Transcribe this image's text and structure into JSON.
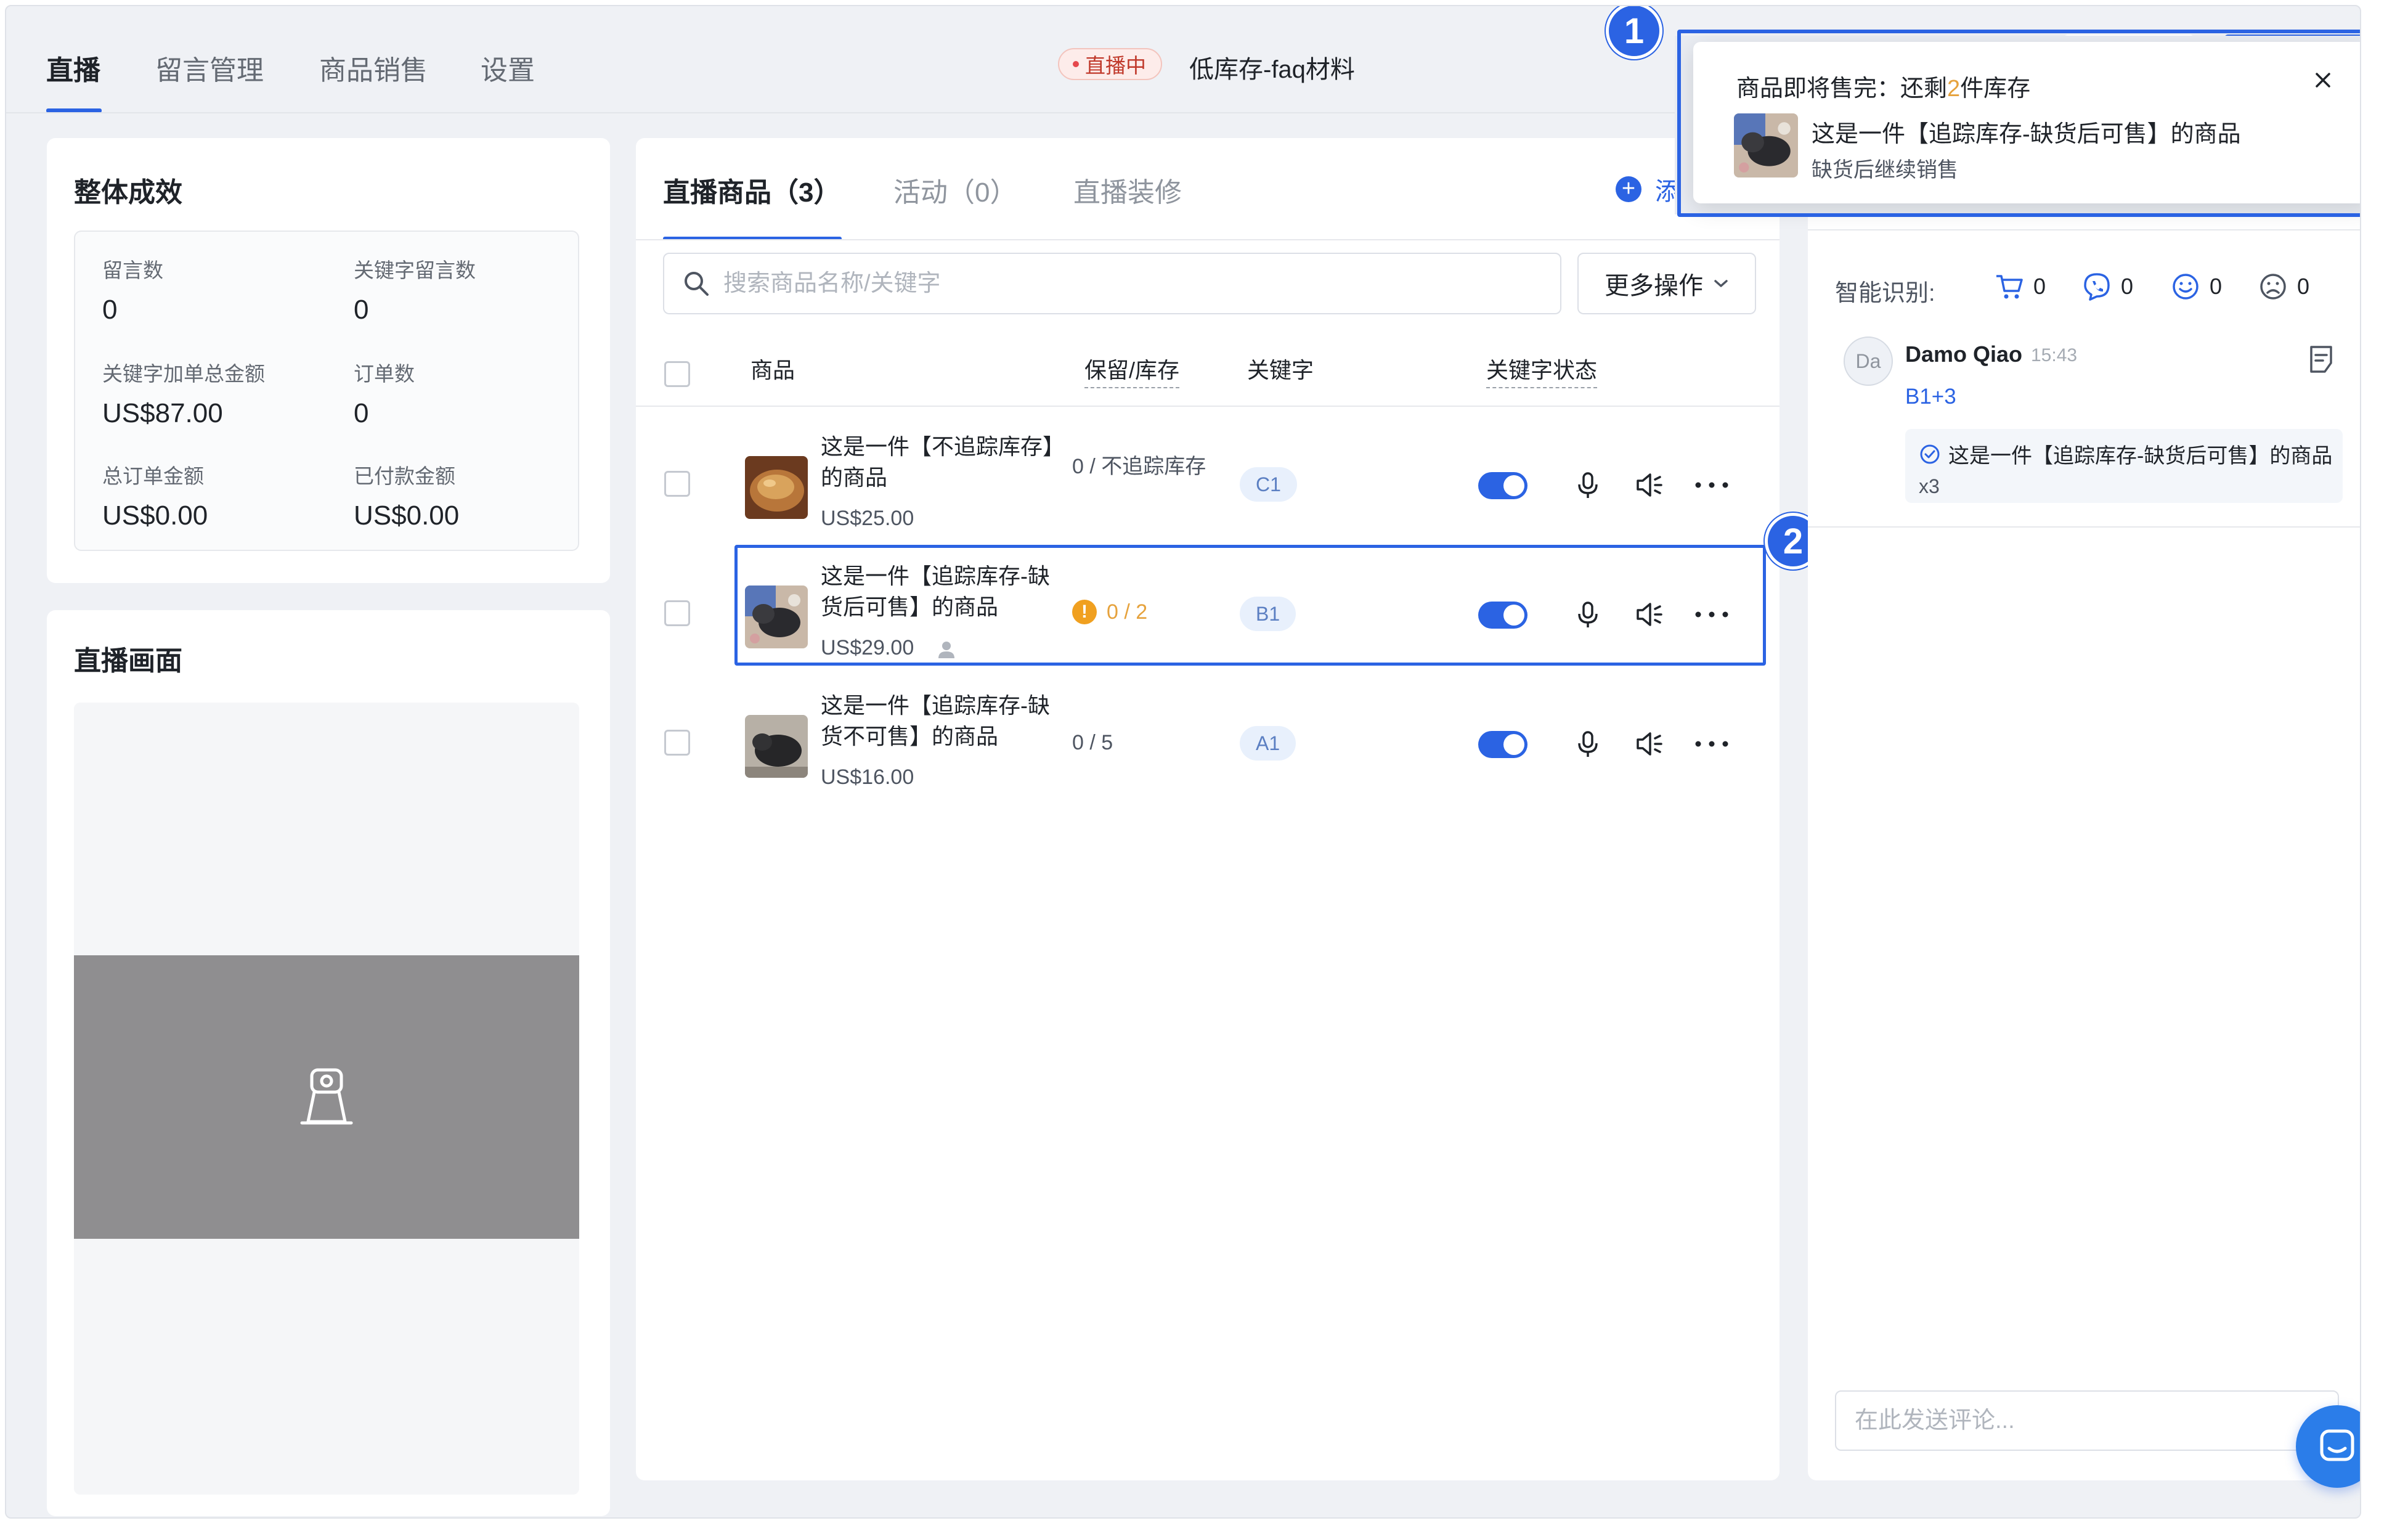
{
  "nav": {
    "tabs": [
      {
        "label": "直播",
        "active": true
      },
      {
        "label": "留言管理",
        "active": false
      },
      {
        "label": "商品销售",
        "active": false
      },
      {
        "label": "设置",
        "active": false
      }
    ],
    "live_status": "直播中",
    "room_name": "低库存-faq材料"
  },
  "performance": {
    "title": "整体成效",
    "stats": [
      {
        "label": "留言数",
        "value": "0"
      },
      {
        "label": "关键字留言数",
        "value": "0"
      },
      {
        "label": "关键字加单总金额",
        "value": "US$87.00"
      },
      {
        "label": "订单数",
        "value": "0"
      },
      {
        "label": "总订单金额",
        "value": "US$0.00"
      },
      {
        "label": "已付款金额",
        "value": "US$0.00"
      }
    ]
  },
  "live_screen": {
    "title": "直播画面"
  },
  "products": {
    "tabs": [
      {
        "label": "直播商品（3）",
        "active": true
      },
      {
        "label": "活动（0）",
        "active": false
      },
      {
        "label": "直播装修",
        "active": false
      }
    ],
    "add_label": "添加",
    "search_placeholder": "搜索商品名称/关键字",
    "more_actions": "更多操作",
    "columns": {
      "product": "商品",
      "stock": "保留/库存",
      "keyword": "关键字",
      "keyword_status": "关键字状态"
    },
    "rows": [
      {
        "name": "这是一件【不追踪库存】的商品",
        "price": "US$25.00",
        "stock": "0 / 不追踪库存",
        "stock_warning": false,
        "keyword": "C1",
        "keyword_enabled": true
      },
      {
        "name": "这是一件【追踪库存-缺货后可售】的商品",
        "price": "US$29.00",
        "stock": "0 / 2",
        "stock_warning": true,
        "keyword": "B1",
        "keyword_enabled": true
      },
      {
        "name": "这是一件【追踪库存-缺货不可售】的商品",
        "price": "US$16.00",
        "stock": "0 / 5",
        "stock_warning": false,
        "keyword": "A1",
        "keyword_enabled": true
      }
    ]
  },
  "comments": {
    "smart_label": "智能识别:",
    "counters": [
      {
        "icon": "cart-icon",
        "value": "0"
      },
      {
        "icon": "phone-chat-icon",
        "value": "0"
      },
      {
        "icon": "smile-icon",
        "value": "0"
      },
      {
        "icon": "sad-icon",
        "value": "0"
      }
    ],
    "items": [
      {
        "avatar": "Da",
        "user": "Damo Qiao",
        "time": "15:43",
        "text": "B1+3",
        "order_product": "这是一件【追踪库存-缺货后可售】的商品",
        "order_qty": "x3"
      }
    ],
    "input_placeholder": "在此发送评论..."
  },
  "toast": {
    "title_prefix": "商品即将售完：还剩",
    "title_number": "2",
    "title_suffix": "件库存",
    "product": "这是一件【追踪库存-缺货后可售】的商品",
    "subtitle": "缺货后继续销售"
  },
  "annotations": [
    "1",
    "2"
  ],
  "colors": {
    "accent": "#2b63e3",
    "warning": "#e6a23c",
    "background": "#eff1f5"
  }
}
